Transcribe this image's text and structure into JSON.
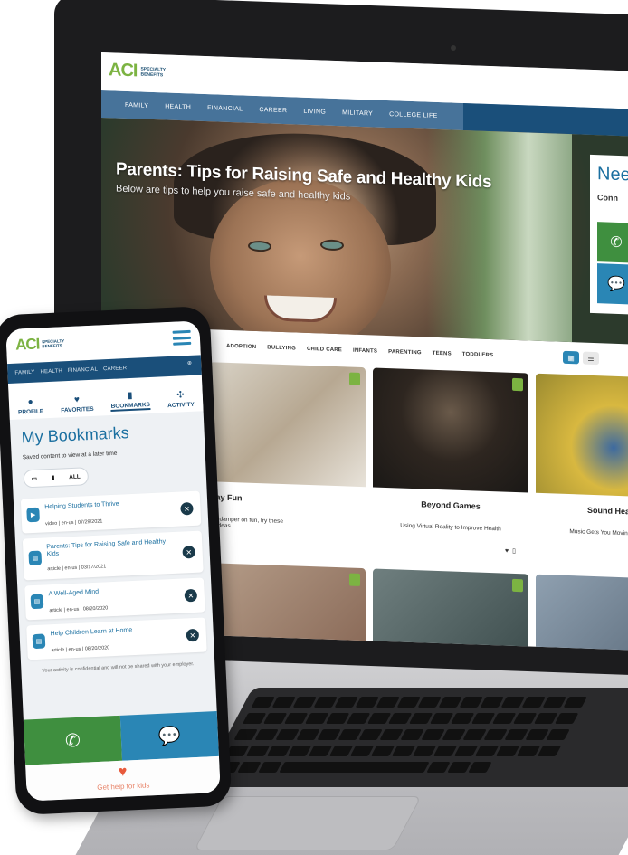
{
  "laptop": {
    "logo": {
      "brand": "ACI",
      "subline": "SPECIALTY BENEFITS"
    },
    "nav": [
      "FAMILY",
      "HEALTH",
      "FINANCIAL",
      "CAREER",
      "LIVING",
      "MILITARY",
      "COLLEGE LIFE"
    ],
    "hero": {
      "title": "Parents: Tips for Raising Safe and Healthy Kids",
      "subtitle": "Below are tips to help you raise safe and healthy kids"
    },
    "side_panel": {
      "title": "Nee",
      "subtitle": "Conn"
    },
    "categories": [
      "ADOPTION",
      "BULLYING",
      "CHILD CARE",
      "INFANTS",
      "PARENTING",
      "TEENS",
      "TODDLERS"
    ],
    "cards": [
      {
        "title": "Day Fun",
        "description": "s a damper on fun, try these",
        "description2": "m ideas"
      },
      {
        "title": "Beyond Games",
        "description": "Using Virtual Reality to Improve Health"
      },
      {
        "title": "Sound Health",
        "description": "Music Gets You Moving and More"
      }
    ]
  },
  "phone": {
    "logo": {
      "brand": "ACI",
      "subline": "SPECIALTY BENEFITS"
    },
    "nav": [
      "FAMILY",
      "HEALTH",
      "FINANCIAL",
      "CAREER"
    ],
    "tabs": [
      {
        "label": "PROFILE",
        "icon": "user-icon",
        "glyph": "●"
      },
      {
        "label": "FAVORITES",
        "icon": "heart-icon",
        "glyph": "♥"
      },
      {
        "label": "BOOKMARKS",
        "icon": "bookmark-icon",
        "glyph": "▮"
      },
      {
        "label": "ACTIVITY",
        "icon": "activity-icon",
        "glyph": "✣"
      }
    ],
    "title": "My Bookmarks",
    "subtitle": "Saved content to view at a later time",
    "filters": {
      "all": "ALL"
    },
    "bookmarks": [
      {
        "title": "Helping Students to Thrive",
        "meta": "video | en-us | 07/29/2021"
      },
      {
        "title": "Parents: Tips for Raising Safe and Healthy Kids",
        "meta": "article | en-us | 03/17/2021"
      },
      {
        "title": "A Well-Aged Mind",
        "meta": "article | en-us | 08/20/2020"
      },
      {
        "title": "Help Children Learn at Home",
        "meta": "article | en-us | 08/20/2020"
      }
    ],
    "notice": "Your activity is confidential and will not be shared with your employer.",
    "footer_text": "Get help for kids"
  },
  "colors": {
    "brand_green": "#7cb342",
    "nav_blue": "#1a4f7a",
    "accent_blue": "#2a86b5",
    "call_green": "#3f8f3f"
  }
}
